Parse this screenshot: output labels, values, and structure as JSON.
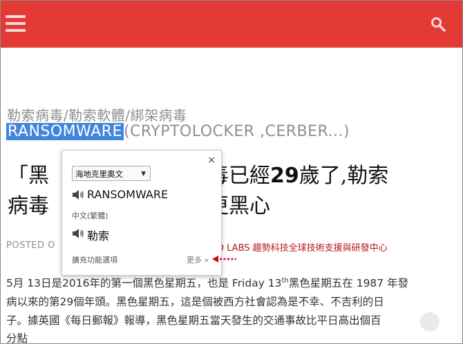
{
  "category": {
    "line1": "勒索病毒/勒索軟體/綁架病毒",
    "highlighted_word": "RANSOMWARE",
    "line2_rest": "(CRYPTOLOCKER ,CERBER...)"
  },
  "title": {
    "line1_a": "「黑",
    "line1_b": "毒已經",
    "line1_num": "29",
    "line1_c": "歲了,勒索",
    "line2_a": "病毒",
    "line2_b": "更黑心"
  },
  "meta": {
    "posted": "POSTED O",
    "labs_prefix": "D LABS",
    "labs_org": "趨勢科技全球技術支援與研發中心"
  },
  "body": {
    "line1_a": "5月 13日是2016年的第一個黑色星期五，也是 Friday 13",
    "line1_sup": "th",
    "line1_b": "黑色星期五在 1987 年發",
    "line2": "病以來的第29個年頭。黑色星期五，這是個被西方社會認為是不幸、不吉利的日",
    "line3": "子。據英國《每日郵報》報導，黑色星期五當天發生的交通事故比平日高出個百",
    "line4": "分點"
  },
  "translator": {
    "source_lang": "海地克里奧文",
    "source_word": "RANSOMWARE",
    "target_lang": "中文(繁體)",
    "translation": "勒索",
    "options_label": "擴充功能選項",
    "more_label": "更多 »",
    "close_symbol": "×"
  },
  "colors": {
    "brand_red": "#e33a36",
    "selection_blue": "#3f86dc",
    "link_red": "#b4171e",
    "annotation_arrow": "#d0021b"
  },
  "icons": {
    "menu": "hamburger-menu-icon",
    "search": "search-icon",
    "speaker": "speaker-icon",
    "close": "close-icon",
    "dropdown": "chevron-down-icon",
    "annotation": "red-dotted-arrow"
  }
}
